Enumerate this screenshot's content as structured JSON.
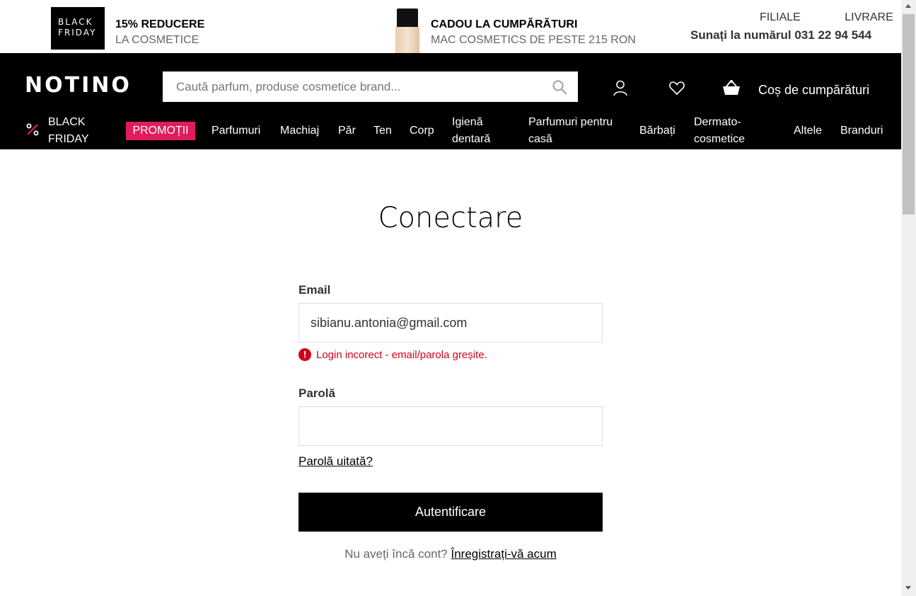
{
  "promo": {
    "bf_line1": "BLACK",
    "bf_line2": "FRIDAY",
    "discount_title": "15% REDUCERE",
    "discount_sub": "LA COSMETICE",
    "gift_title": "CADOU LA CUMPĂRĂTURI",
    "gift_sub": "MAC COSMETICS DE PESTE 215 RON"
  },
  "top_links": {
    "stores": "FILIALE",
    "delivery": "LIVRARE",
    "phone": "Sunați la numărul 031 22 94 544"
  },
  "header": {
    "logo": "NOTINO",
    "search_placeholder": "Caută parfum, produse cosmetice brand...",
    "cart_label": "Coș de cumpărături"
  },
  "nav": {
    "black_friday_1": "BLACK",
    "black_friday_2": "FRIDAY",
    "promo": "PROMOȚII",
    "items": [
      "Parfumuri",
      "Machiaj",
      "Păr",
      "Ten",
      "Corp"
    ],
    "dental_1": "Igienă",
    "dental_2": "dentară",
    "home_1": "Parfumuri pentru",
    "home_2": "casă",
    "men": "Bărbați",
    "derma_1": "Dermato-",
    "derma_2": "cosmetice",
    "other": "Altele",
    "brands": "Branduri"
  },
  "login": {
    "title": "Conectare",
    "email_label": "Email",
    "email_value": "sibianu.antonia@gmail.com",
    "error": "Login incorect - email/parola greșite.",
    "password_label": "Parolă",
    "password_value": "",
    "forgot": "Parolă uitată?",
    "submit": "Autentificare",
    "no_account": "Nu aveți încă cont?",
    "register_link": "Înregistrați-vă acum"
  },
  "colors": {
    "accent": "#e01c5d",
    "error": "#d0021b",
    "header_bg": "#000000"
  }
}
